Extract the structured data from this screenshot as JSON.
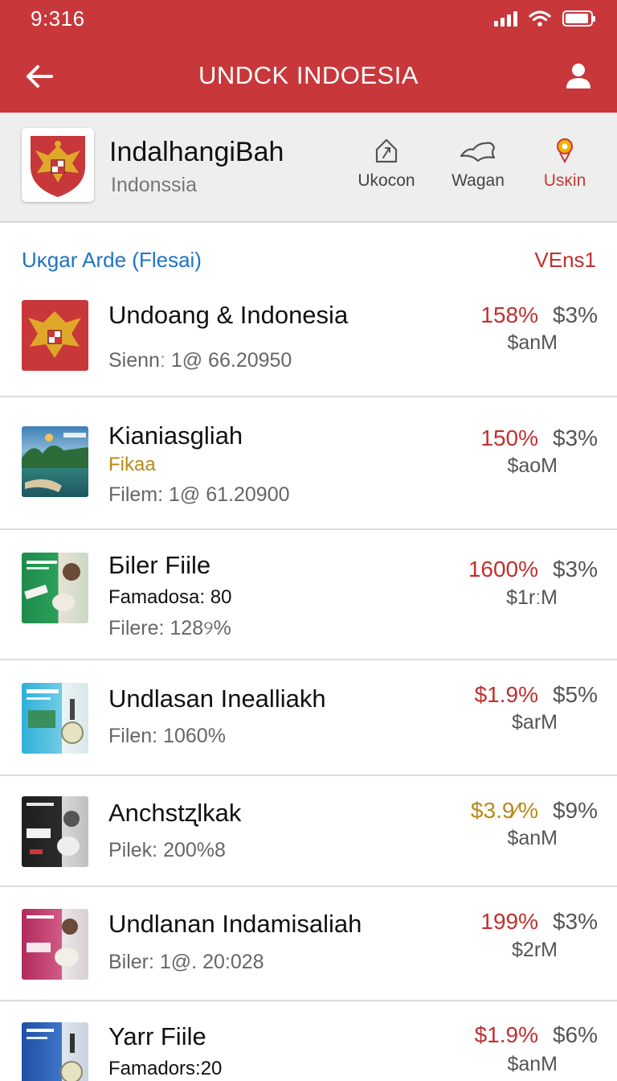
{
  "status_bar": {
    "time": "9:316"
  },
  "app_bar": {
    "title": "UNDCK  INDOESIA"
  },
  "header": {
    "name": "IndalhangiBah",
    "subtitle": "Indonssia",
    "actions": [
      {
        "label": "Ukocon",
        "icon": "house-arrow-icon"
      },
      {
        "label": "Wagan",
        "icon": "map-shape-icon"
      },
      {
        "label": "Usĸin",
        "icon": "pin-icon",
        "active": true
      }
    ]
  },
  "section": {
    "title": "Uĸgar Arde (Flesai)",
    "right_label": "VEns1"
  },
  "colors": {
    "brand": "#c8373a",
    "link": "#1f73c8",
    "red_value": "#c0302f",
    "gold_value": "#b98a16"
  },
  "items": [
    {
      "title": "Undoang & Indonesia",
      "sub": "",
      "meta": "Siennː 1@ 66.20950",
      "pct": "158%",
      "pct2": "$3%",
      "amount": "$anM",
      "pct_color": "red",
      "thumb": "emblem"
    },
    {
      "title": "Kianiasgliah",
      "sub": "Fikaa",
      "meta": "Filem: 1@ 61.20900",
      "pct": "150%",
      "pct2": "$3%",
      "amount": "$aoM",
      "pct_color": "red",
      "thumb": "lake"
    },
    {
      "title": "Бiler Fiile",
      "sub": "Famadosa: 80",
      "meta": "Filere:  128୨%",
      "pct": "1600%",
      "pct2": "$3%",
      "amount": "$1rːM",
      "pct_color": "red",
      "thumb": "green"
    },
    {
      "title": "Undlasan Inealliakh",
      "sub": "",
      "meta": "Filen: 1060%",
      "pct": "$1.9%",
      "pct2": "$5%",
      "amount": "$arM",
      "pct_color": "mixed",
      "thumb": "cyan"
    },
    {
      "title": "Anchstʐlkak",
      "sub": "",
      "meta": "Pilek: 200%8",
      "pct": "$3.9⁄%",
      "pct2": "$9%",
      "amount": "$anM",
      "pct_color": "mixed",
      "thumb": "dark"
    },
    {
      "title": "Undlanan Indamisaliah",
      "sub": "",
      "meta": "Biler:  1@. 20:028",
      "pct": "199%",
      "pct2": "$3%",
      "amount": "$2rM",
      "pct_color": "red",
      "thumb": "pink"
    },
    {
      "title": "Yarr Fiile",
      "sub": "Famadors:20",
      "meta": "",
      "pct": "$1.9%",
      "pct2": "$6%",
      "amount": "$anM",
      "pct_color": "red",
      "thumb": "blue"
    }
  ]
}
